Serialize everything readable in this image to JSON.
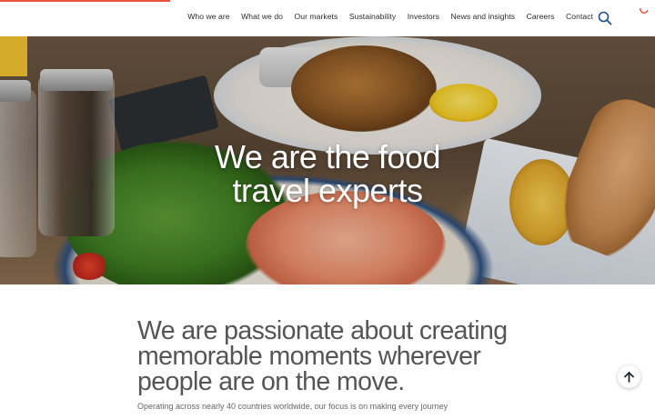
{
  "header": {
    "nav": [
      {
        "label": "Who we are"
      },
      {
        "label": "What we do"
      },
      {
        "label": "Our markets"
      },
      {
        "label": "Sustainability"
      },
      {
        "label": "Investors"
      },
      {
        "label": "News and insights"
      },
      {
        "label": "Careers"
      },
      {
        "label": "Contact"
      }
    ],
    "search_icon": "search-icon",
    "accent_color": "#e8533a",
    "scroll_progress": 0.26
  },
  "hero": {
    "title_line1": "We are the food",
    "title_line2": "travel experts"
  },
  "intro": {
    "heading_line1": "We are passionate about creating",
    "heading_line2": "memorable moments wherever",
    "heading_line3": "people are on the move.",
    "body": "Operating across nearly 40 countries worldwide, our focus is on making every journey"
  },
  "scroll_top": {
    "icon": "arrow-up-icon"
  }
}
